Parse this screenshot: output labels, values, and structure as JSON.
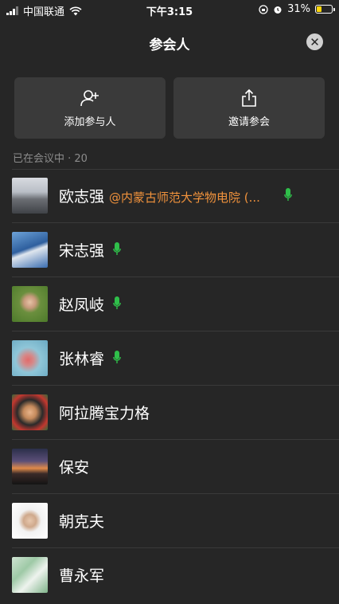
{
  "status": {
    "carrier": "中国联通",
    "time": "下午3:15",
    "battery": "31%",
    "battery_level": 0.31,
    "battery_color": "#ffd60a"
  },
  "header": {
    "title": "参会人",
    "close_icon": "close-icon"
  },
  "actions": [
    {
      "label": "添加参与人",
      "icon": "add-person-icon"
    },
    {
      "label": "邀请参会",
      "icon": "share-icon"
    }
  ],
  "section": {
    "label": "已在会议中 · 20"
  },
  "participants": [
    {
      "name": "欧志强",
      "org": "@内蒙古师范大学物电院 (...",
      "mic": true
    },
    {
      "name": "宋志强",
      "org": "",
      "mic": true
    },
    {
      "name": "赵凤岐",
      "org": "",
      "mic": true
    },
    {
      "name": "张林睿",
      "org": "",
      "mic": true
    },
    {
      "name": "阿拉腾宝力格",
      "org": "",
      "mic": false
    },
    {
      "name": "保安",
      "org": "",
      "mic": false
    },
    {
      "name": "朝克夫",
      "org": "",
      "mic": false
    },
    {
      "name": "曹永军",
      "org": "",
      "mic": false
    }
  ],
  "colors": {
    "background": "#262626",
    "button_bg": "#3a3a3a",
    "org_text": "#f0923c",
    "mic_on": "#2fbf4a"
  }
}
